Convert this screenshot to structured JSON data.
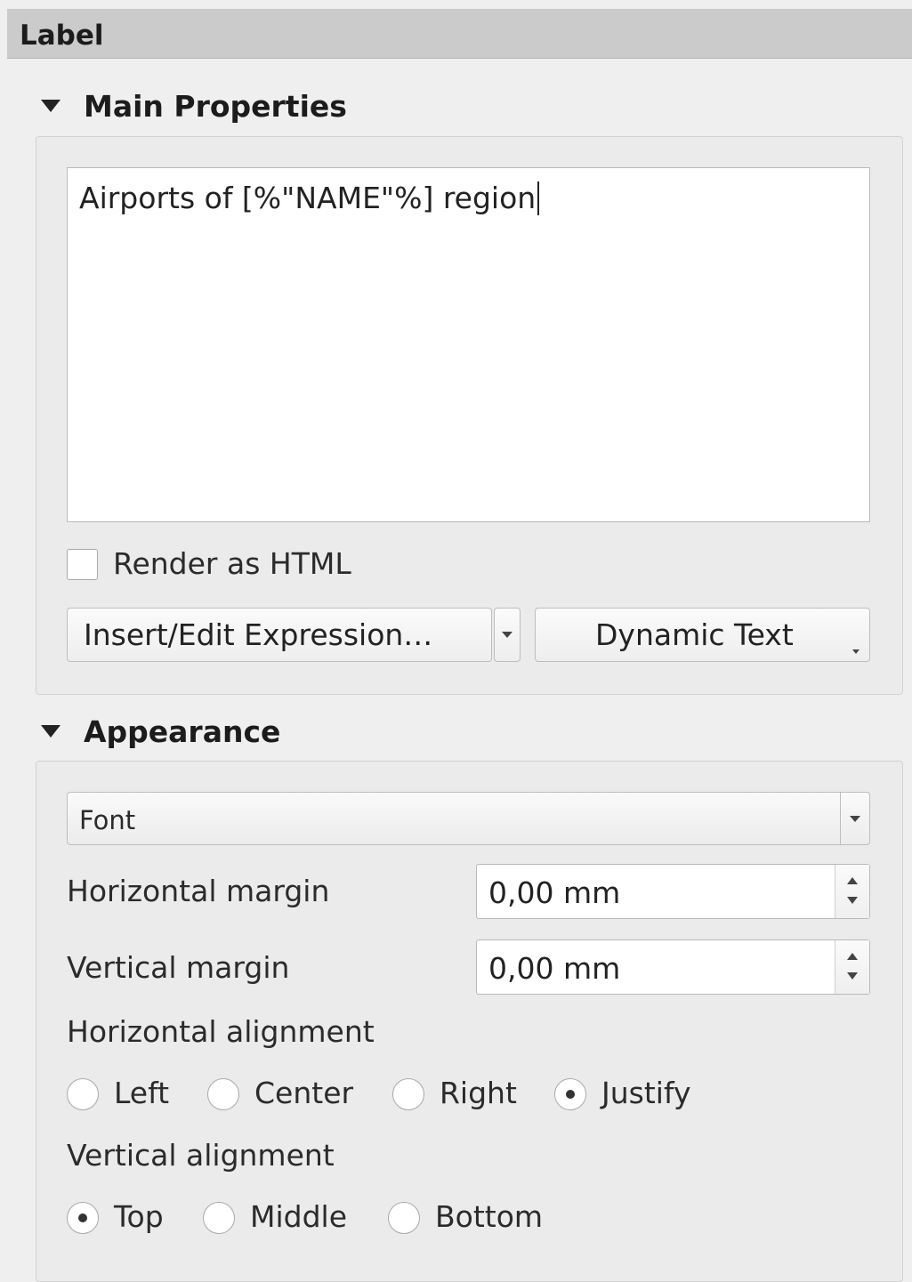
{
  "panel": {
    "title": "Label"
  },
  "main_properties": {
    "header": "Main Properties",
    "text_value": "Airports of [%\"NAME\"%] region",
    "render_html_label": "Render as HTML",
    "render_html_checked": false,
    "insert_expression_label": "Insert/Edit Expression…",
    "dynamic_text_label": "Dynamic Text"
  },
  "appearance": {
    "header": "Appearance",
    "font_label": "Font",
    "horizontal_margin_label": "Horizontal margin",
    "horizontal_margin_value": "0,00 mm",
    "vertical_margin_label": "Vertical margin",
    "vertical_margin_value": "0,00 mm",
    "horizontal_alignment_label": "Horizontal alignment",
    "horizontal_options": [
      "Left",
      "Center",
      "Right",
      "Justify"
    ],
    "horizontal_selected": "Justify",
    "vertical_alignment_label": "Vertical alignment",
    "vertical_options": [
      "Top",
      "Middle",
      "Bottom"
    ],
    "vertical_selected": "Top"
  },
  "icons": {
    "collapse": "triangle-down-icon",
    "dropdown": "chevron-down-icon",
    "spin": "spin-up-down-icon"
  }
}
